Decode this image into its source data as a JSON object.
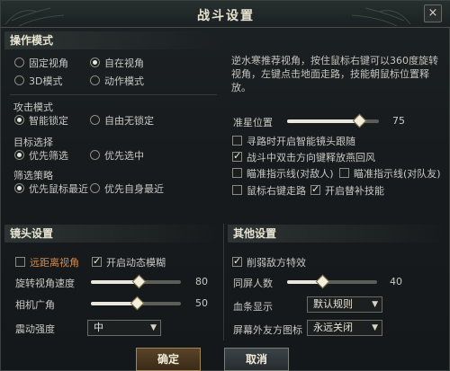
{
  "dialog": {
    "title": "战斗设置",
    "close_glyph": "×"
  },
  "operation": {
    "header": "操作模式",
    "camera_options": [
      "固定视角",
      "自在视角",
      "3D模式",
      "动作模式"
    ],
    "camera_selected": "自在视角",
    "hint": "逆水寒推荐视角，按住鼠标右键可以360度旋转视角，左键点击地面走路，技能朝鼠标位置释放。",
    "attack_mode_label": "攻击模式",
    "attack_options": [
      "智能锁定",
      "自由无锁定"
    ],
    "attack_selected": "智能锁定",
    "target_label": "目标选择",
    "target_options": [
      "优先筛选",
      "优先选中"
    ],
    "target_selected": "优先筛选",
    "filter_label": "筛选策略",
    "filter_options": [
      "优先鼠标最近",
      "优先自身最近"
    ],
    "filter_selected": "优先鼠标最近",
    "crosshair_label": "准星位置",
    "crosshair_value": "75",
    "crosshair_level": 0.75,
    "checks": [
      {
        "label": "寻路时开启智能镜头跟随",
        "checked": false
      },
      {
        "label": "战斗中双击方向键释放燕回风",
        "checked": true
      },
      {
        "label": "瞄准指示线(对敌人)",
        "checked": false
      },
      {
        "label": "瞄准指示线(对队友)",
        "checked": false
      },
      {
        "label": "鼠标右键走路",
        "checked": false
      },
      {
        "label": "开启替补技能",
        "checked": true
      }
    ]
  },
  "camera": {
    "header": "镜头设置",
    "far_view_label": "远距离视角",
    "far_view_checked": false,
    "motion_blur_label": "开启动态模糊",
    "motion_blur_checked": true,
    "rotate_speed_label": "旋转视角速度",
    "rotate_speed_value": "80",
    "rotate_speed_level": 0.8,
    "fov_label": "相机广角",
    "fov_value": "50",
    "fov_level": 0.5,
    "shake_label": "震动强度",
    "shake_value": "中"
  },
  "other": {
    "header": "其他设置",
    "weaken_enemy_fx_label": "削弱敌方特效",
    "weaken_enemy_fx_checked": true,
    "same_screen_label": "同屏人数",
    "same_screen_value": "40",
    "same_screen_level": 0.4,
    "hp_bar_label": "血条显示",
    "hp_bar_value": "默认规则",
    "friend_icon_label": "屏幕外友方图标",
    "friend_icon_value": "永远关闭"
  },
  "footer": {
    "confirm": "确定",
    "cancel": "取消"
  },
  "colors": {
    "accent_gold": "#a0875a",
    "warning_orange": "#d98a4a",
    "panel_bg": "#171b1d"
  },
  "icons": {
    "radio": "radio-icon",
    "checkbox": "checkbox-icon",
    "dropdown": "chevron-down-icon",
    "close": "close-icon"
  }
}
